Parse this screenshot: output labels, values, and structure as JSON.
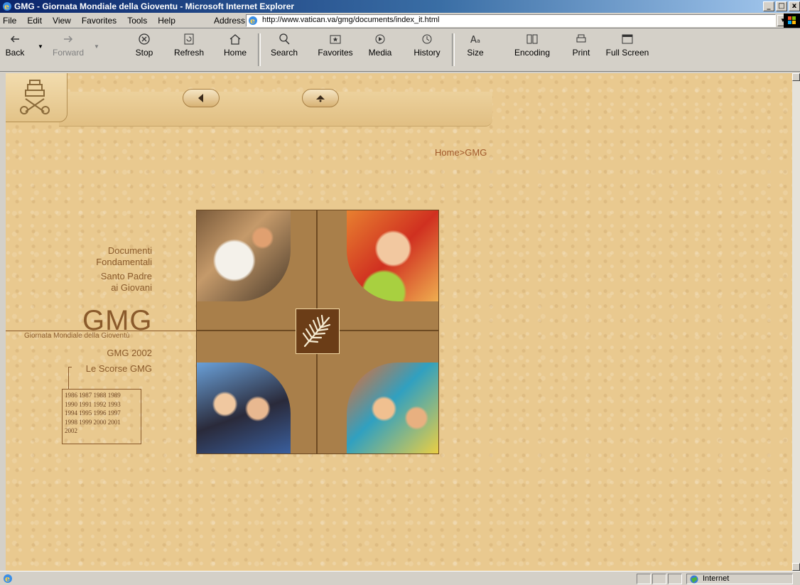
{
  "window": {
    "title": "GMG - Giornata Mondiale della Gioventu - Microsoft Internet Explorer",
    "controls": [
      "_",
      "□",
      "x"
    ]
  },
  "menu": [
    "File",
    "Edit",
    "View",
    "Favorites",
    "Tools",
    "Help"
  ],
  "address": {
    "label": "Address",
    "url": "http://www.vatican.va/gmg/documents/index_it.html"
  },
  "toolbar": {
    "back": "Back",
    "forward": "Forward",
    "stop": "Stop",
    "refresh": "Refresh",
    "home": "Home",
    "search": "Search",
    "favorites": "Favorites",
    "media": "Media",
    "history": "History",
    "size": "Size",
    "encoding": "Encoding",
    "print": "Print",
    "fullscreen": "Full Screen"
  },
  "page": {
    "breadcrumb": "Home>GMG",
    "menu": {
      "documenti_line1": "Documenti",
      "documenti_line2": "Fondamentali",
      "santo_line1": "Santo Padre",
      "santo_line2": "ai Giovani",
      "gmg": "GMG",
      "gmg_sub": "Giornata Mondiale della Gioventù",
      "gmg2002": "GMG 2002",
      "scorse": "Le Scorse GMG"
    },
    "years": [
      "1986 1987 1988 1989",
      "1990 1991 1992 1993",
      "1994 1995 1996 1997",
      "1998 1999 2000 2001",
      "2002"
    ]
  },
  "status": {
    "zone": "Internet"
  },
  "colors": {
    "page_bg": "#e9c98f",
    "menu_text": "#8a5a2b",
    "breadcrumb": "#a0582a",
    "title_bar": "#0a246a"
  }
}
